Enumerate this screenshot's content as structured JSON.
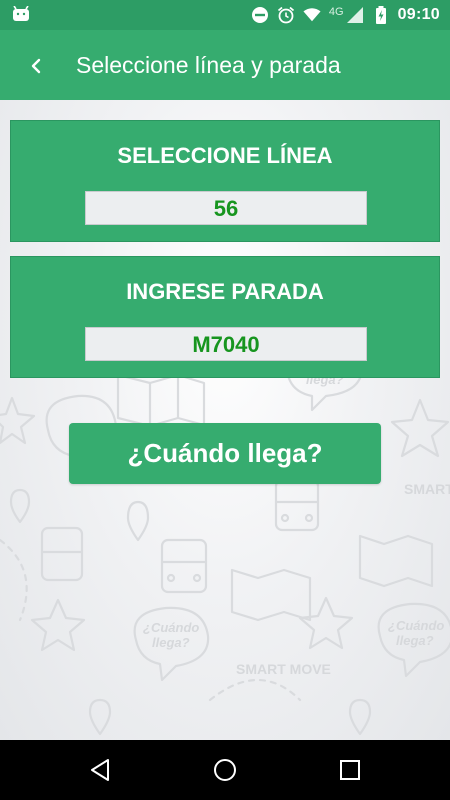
{
  "status_bar": {
    "time": "09:10",
    "network_label": "4G",
    "icons": [
      "android-icon",
      "do-not-disturb-icon",
      "alarm-icon",
      "wifi-icon",
      "signal-icon",
      "battery-charging-icon"
    ]
  },
  "app_bar": {
    "title": "Seleccione línea y parada",
    "back_icon": "back-arrow-icon"
  },
  "line_card": {
    "title": "SELECCIONE LÍNEA",
    "value": "56"
  },
  "stop_card": {
    "title": "INGRESE PARADA",
    "value": "M7040"
  },
  "main_button": {
    "label": "¿Cuándo llega?"
  },
  "background": {
    "watermark_texts": [
      "¿Cuándo llega?",
      "SMART MOVE"
    ]
  },
  "nav_bar": {
    "icons": [
      "nav-back-icon",
      "nav-home-icon",
      "nav-recents-icon"
    ]
  },
  "colors": {
    "status_bar": "#2d9d65",
    "primary": "#36ac6f",
    "value_text": "#17951f",
    "value_box": "#eceef0",
    "background": "#ecedef",
    "nav_bar": "#000000"
  }
}
